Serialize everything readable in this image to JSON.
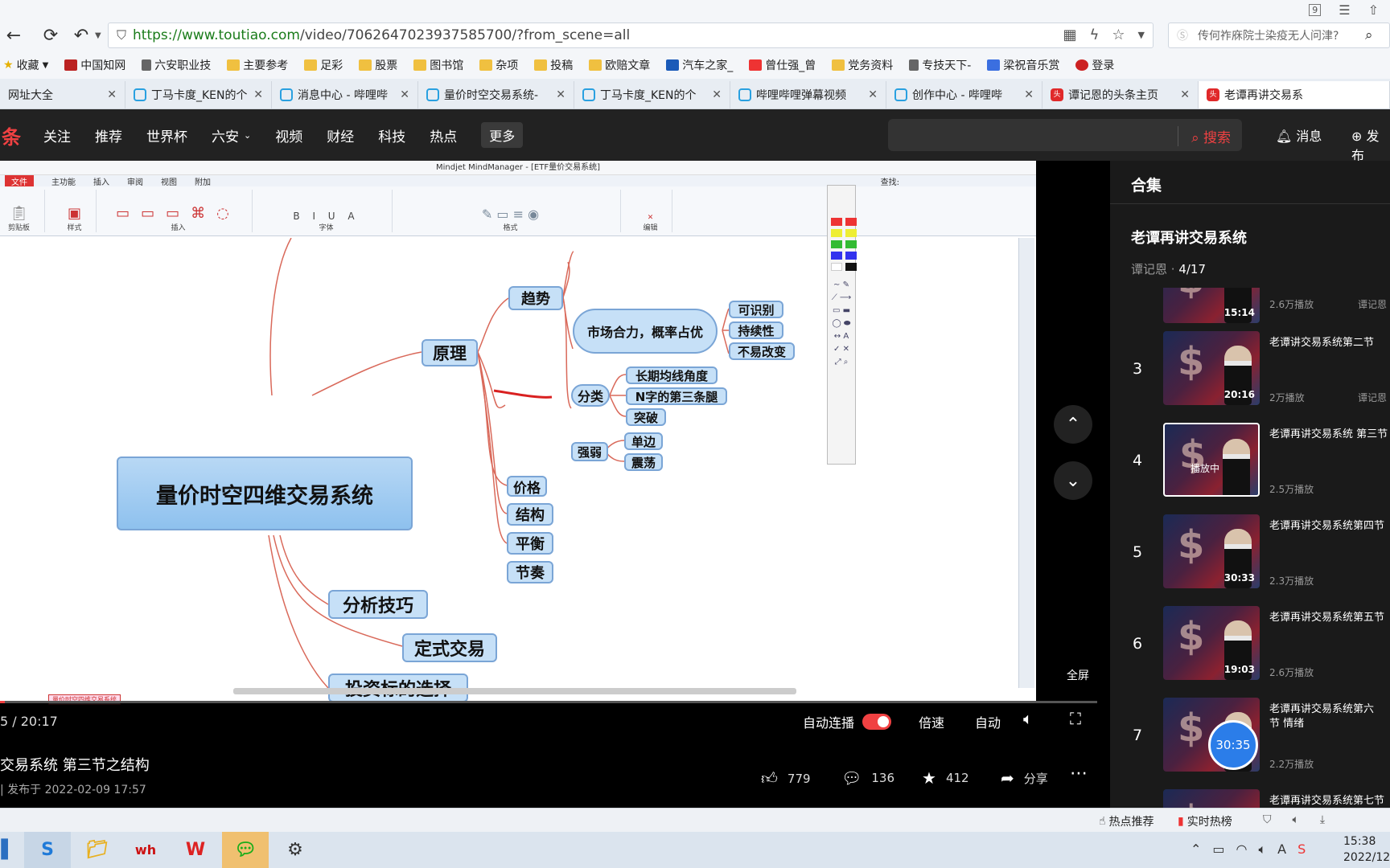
{
  "browser": {
    "url_host": "https://www.toutiao.com",
    "url_path": "/video/7062647023937585700/?from_scene=all",
    "search_hint": "传何祚庥院士染疫无人问津?",
    "tab_counter": "9",
    "bookmarks": [
      "收藏",
      "中国知网",
      "六安职业技",
      "主要参考",
      "足彩",
      "股票",
      "图书馆",
      "杂项",
      "投稿",
      "欧赔文章",
      "汽车之家_",
      "曾仕强_曾",
      "党务资料",
      "专技天下-",
      "梁祝音乐赏",
      "登录"
    ],
    "tabs": [
      "网址大全",
      "丁马卡度_KEN的个",
      "消息中心 - 哔哩哔",
      "量价时空交易系统-",
      "丁马卡度_KEN的个",
      "哔哩哔哩弹幕视频",
      "创作中心 - 哔哩哔",
      "谭记恩的头条主页",
      "老谭再讲交易系"
    ]
  },
  "site": {
    "logo": "条",
    "nav": [
      "关注",
      "推荐",
      "世界杯",
      "六安",
      "视频",
      "财经",
      "科技",
      "热点"
    ],
    "more": "更多",
    "search_button": "搜索",
    "messages": "消息",
    "publish": "发布"
  },
  "mindmanager": {
    "title": "Mindjet MindManager - [ETF量价交易系统]",
    "menu": [
      "文件",
      "主功能",
      "插入",
      "审阅",
      "视图",
      "附加"
    ],
    "ribbon_groups": [
      "剪贴板",
      "样式",
      "插入",
      "字体",
      "格式",
      "编辑"
    ],
    "find_label": "查找:",
    "central": "量价时空四维交易系统",
    "nodes": {
      "yuanli": "原理",
      "qushi": "趋势",
      "shichang": "市场合力，概率占优",
      "keshibie": "可识别",
      "chixuxing": "持续性",
      "buyigaibian": "不易改变",
      "fenlei": "分类",
      "changqi": "长期均线角度",
      "nzi": "N字的第三条腿",
      "tupo": "突破",
      "qiangruo": "强弱",
      "danbian": "单边",
      "zhendang": "震荡",
      "jiage": "价格",
      "jiegou": "结构",
      "pingheng": "平衡",
      "jiezou": "节奏",
      "fenxi": "分析技巧",
      "dingshi": "定式交易",
      "touzi": "投资标的选择"
    },
    "doc_tab": "量价时空四维交易系统"
  },
  "player": {
    "time": "5 / 20:17",
    "autoplay": "自动连播",
    "speed": "倍速",
    "quality": "自动",
    "fullscreen": "全屏",
    "progress": 0.004
  },
  "video": {
    "title": "交易系统 第三节之结构",
    "meta": "| 发布于 2022-02-09 17:57",
    "likes": "779",
    "comments": "136",
    "favorites": "412",
    "share": "分享"
  },
  "playlist": {
    "header": "合集",
    "title": "老谭再讲交易系统",
    "author": "谭记恩",
    "position": "4/17",
    "items": [
      {
        "num": "",
        "title": "",
        "dur": "15:14",
        "plays": "2.6万播放",
        "author": "谭记恩"
      },
      {
        "num": "3",
        "title": "老谭讲交易系统第二节",
        "dur": "20:16",
        "plays": "2万播放",
        "author": "谭记恩"
      },
      {
        "num": "4",
        "title": "老谭再讲交易系统 第三节",
        "dur": "",
        "plays": "2.5万播放",
        "author": "",
        "playing": "播放中"
      },
      {
        "num": "5",
        "title": "老谭再讲交易系统第四节",
        "dur": "30:33",
        "plays": "2.3万播放",
        "author": ""
      },
      {
        "num": "6",
        "title": "老谭再讲交易系统第五节",
        "dur": "19:03",
        "plays": "2.6万播放",
        "author": ""
      },
      {
        "num": "7",
        "title": "老谭再讲交易系统第六节 情绪",
        "dur": "",
        "plays": "2.2万播放",
        "author": ""
      },
      {
        "num": "",
        "title": "老谭再讲交易系统第七节",
        "dur": "",
        "plays": "",
        "author": ""
      }
    ],
    "timer": "30:35"
  },
  "statusbar": {
    "hot": "热点推荐",
    "realtime": "实时热榜"
  },
  "taskbar": {
    "clock_time": "15:38",
    "clock_date": "2022/12"
  }
}
